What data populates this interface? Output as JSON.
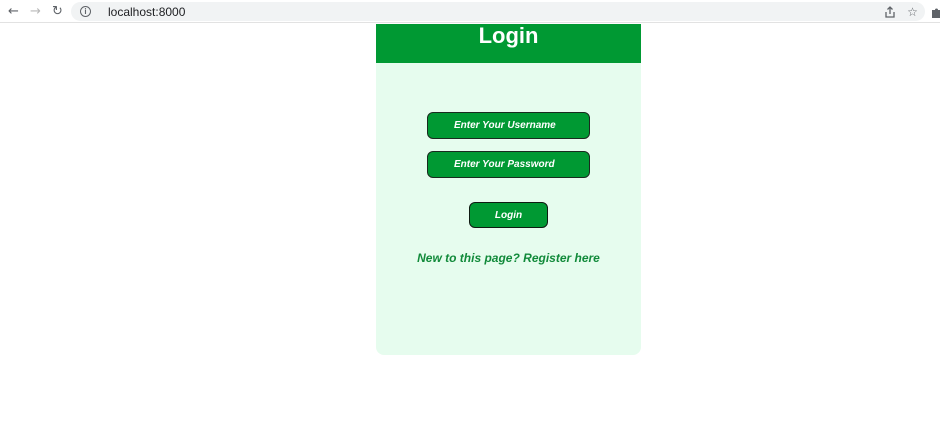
{
  "browser": {
    "url": "localhost:8000",
    "back_icon": "arrow-left-icon",
    "forward_icon": "arrow-right-icon",
    "reload_icon": "reload-icon",
    "info_icon": "info-icon",
    "share_icon": "share-icon",
    "bookmark_icon": "star-icon",
    "extensions_icon": "puzzle-icon"
  },
  "login": {
    "title": "Login",
    "username_placeholder": "Enter Your Username",
    "password_placeholder": "Enter Your Password",
    "submit_label": "Login",
    "register_text": "New to this page? Register here"
  },
  "colors": {
    "primary_green": "#009933",
    "card_background": "#e6fcee",
    "link_green": "#118a3a"
  }
}
